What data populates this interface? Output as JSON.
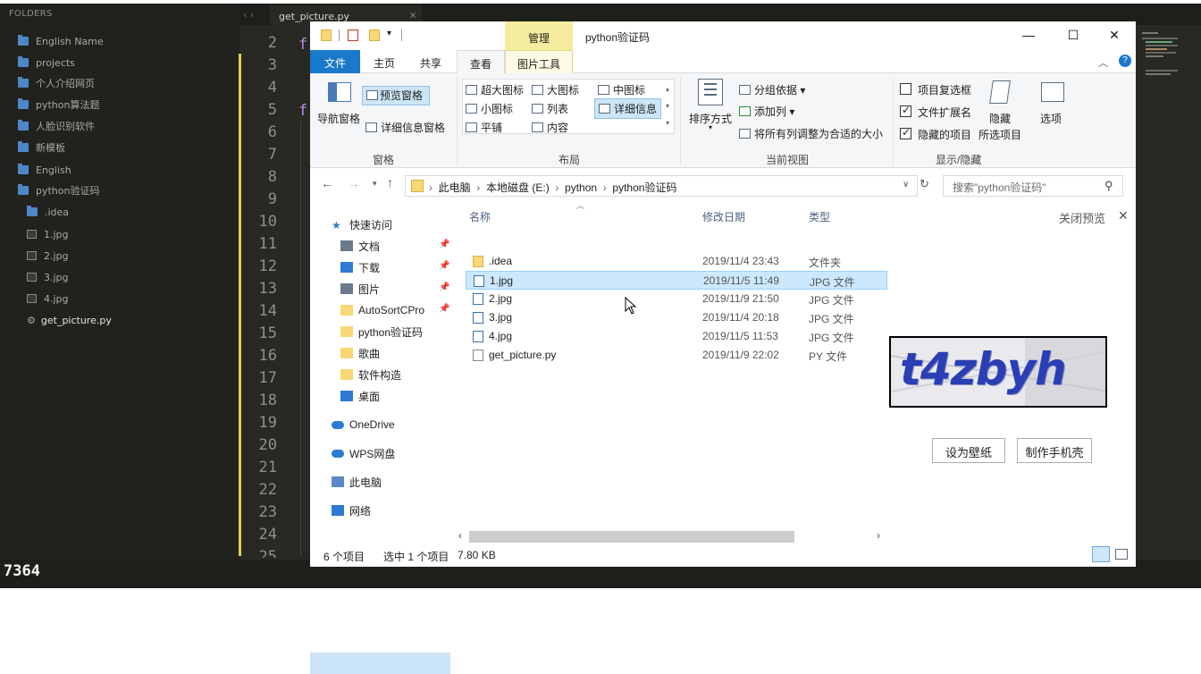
{
  "sublime": {
    "folders_header": "FOLDERS",
    "sidebar_items": [
      {
        "label": "English Name",
        "icon": "folder-icon"
      },
      {
        "label": "projects",
        "icon": "folder-icon"
      },
      {
        "label": "个人介绍网页",
        "icon": "folder-icon"
      },
      {
        "label": "python算法题",
        "icon": "folder-icon"
      },
      {
        "label": "人脸识别软件",
        "icon": "folder-icon"
      },
      {
        "label": "新模板",
        "icon": "folder-icon"
      },
      {
        "label": "English",
        "icon": "folder-icon"
      },
      {
        "label": "python验证码",
        "icon": "folder-open-icon"
      },
      {
        "label": ".idea",
        "icon": "folder-icon"
      },
      {
        "label": "1.jpg",
        "icon": "image-file-icon"
      },
      {
        "label": "2.jpg",
        "icon": "image-file-icon"
      },
      {
        "label": "3.jpg",
        "icon": "image-file-icon"
      },
      {
        "label": "4.jpg",
        "icon": "image-file-icon"
      },
      {
        "label": "get_picture.py",
        "icon": "python-file-icon"
      }
    ],
    "tab_nav": "‹  ›",
    "tab_title": "get_picture.py",
    "tab_close": "×",
    "line_numbers": [
      "2",
      "3",
      "4",
      "5",
      "6",
      "7",
      "8",
      "9",
      "10",
      "11",
      "12",
      "13",
      "14",
      "15",
      "16",
      "17",
      "18",
      "19",
      "20",
      "21",
      "22",
      "23",
      "24",
      "25"
    ],
    "code_char_1": "f",
    "code_char_2": "f",
    "console_output": "7364"
  },
  "explorer": {
    "manage_tab": "管理",
    "window_title": "python验证码",
    "window_buttons": {
      "minimize": "—",
      "maximize": "☐",
      "close": "✕"
    },
    "ribbon_tabs": {
      "file": "文件",
      "home": "主页",
      "share": "共享",
      "view": "查看",
      "picture_tools": "图片工具"
    },
    "ribbon": {
      "nav_pane": "导航窗格",
      "preview_pane": "预览窗格",
      "details_pane": "详细信息窗格",
      "group_pane": "窗格",
      "extra_large_icons": "超大图标",
      "large_icons": "大图标",
      "medium_icons": "中图标",
      "small_icons": "小图标",
      "list": "列表",
      "details": "详细信息",
      "tiles": "平铺",
      "content": "内容",
      "group_layout": "布局",
      "sort_by": "排序方式",
      "group_by": "分组依据",
      "add_column": "添加列",
      "size_columns": "将所有列调整为合适的大小",
      "group_current_view": "当前视图",
      "item_checkboxes": "项目复选框",
      "file_extensions": "文件扩展名",
      "hidden_items": "隐藏的项目",
      "hide_selected_1": "隐藏",
      "hide_selected_2": "所选项目",
      "options": "选项",
      "group_show_hide": "显示/隐藏",
      "item_checkboxes_checked": false,
      "file_extensions_checked": true,
      "hidden_items_checked": true
    },
    "breadcrumb": [
      "此电脑",
      "本地磁盘 (E:)",
      "python",
      "python验证码"
    ],
    "search_placeholder": "搜索\"python验证码\"",
    "nav_pane": [
      {
        "label": "快速访问",
        "icon": "star-icon",
        "pinned": false
      },
      {
        "label": "文档",
        "icon": "document-icon",
        "pinned": true
      },
      {
        "label": "下载",
        "icon": "download-icon",
        "pinned": true
      },
      {
        "label": "图片",
        "icon": "pictures-icon",
        "pinned": true
      },
      {
        "label": "AutoSortCPro",
        "icon": "folder-icon",
        "pinned": true
      },
      {
        "label": "python验证码",
        "icon": "folder-icon",
        "pinned": false
      },
      {
        "label": "歌曲",
        "icon": "folder-icon",
        "pinned": false
      },
      {
        "label": "软件构造",
        "icon": "folder-icon",
        "pinned": false
      },
      {
        "label": "桌面",
        "icon": "desktop-icon",
        "pinned": false
      },
      {
        "label": "OneDrive",
        "icon": "cloud-icon",
        "pinned": false
      },
      {
        "label": "WPS网盘",
        "icon": "cloud-icon",
        "pinned": false
      },
      {
        "label": "此电脑",
        "icon": "computer-icon",
        "pinned": false
      },
      {
        "label": "网络",
        "icon": "network-icon",
        "pinned": false
      }
    ],
    "columns": {
      "name": "名称",
      "date": "修改日期",
      "type": "类型"
    },
    "files": [
      {
        "name": ".idea",
        "date": "2019/11/4 23:43",
        "type": "文件夹",
        "icon": "folder-icon",
        "selected": false
      },
      {
        "name": "1.jpg",
        "date": "2019/11/5 11:49",
        "type": "JPG 文件",
        "icon": "image-file-icon",
        "selected": true
      },
      {
        "name": "2.jpg",
        "date": "2019/11/9 21:50",
        "type": "JPG 文件",
        "icon": "image-file-icon",
        "selected": false
      },
      {
        "name": "3.jpg",
        "date": "2019/11/4 20:18",
        "type": "JPG 文件",
        "icon": "image-file-icon",
        "selected": false
      },
      {
        "name": "4.jpg",
        "date": "2019/11/5 11:53",
        "type": "JPG 文件",
        "icon": "image-file-icon",
        "selected": false
      },
      {
        "name": "get_picture.py",
        "date": "2019/11/9 22:02",
        "type": "PY 文件",
        "icon": "python-file-icon",
        "selected": false
      }
    ],
    "preview": {
      "close_label": "关闭预览",
      "captcha_text": "t4zbyh",
      "set_wallpaper": "设为壁纸",
      "make_phone_case": "制作手机壳"
    },
    "status": {
      "count": "6 个项目",
      "selected": "选中 1 个项目",
      "size": "7.80 KB"
    },
    "colors": {
      "accent": "#1979ca",
      "selection": "#cce8ff",
      "manage_tab": "#f6ec9e"
    }
  }
}
